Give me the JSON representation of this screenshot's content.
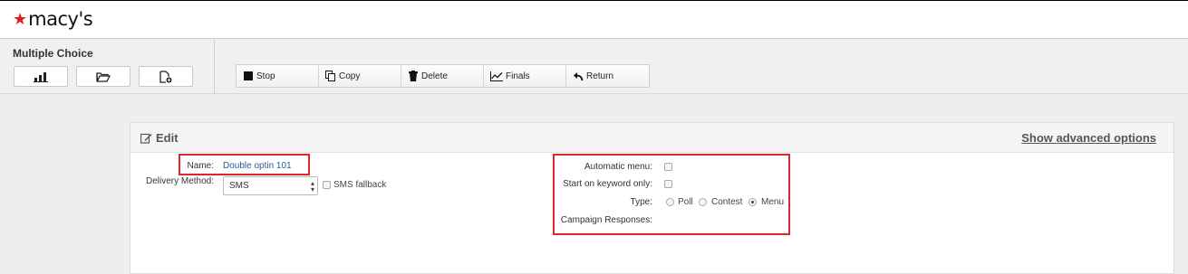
{
  "brand": {
    "name": "macy's",
    "star_color": "#e11b22"
  },
  "panel": {
    "title": "Multiple Choice"
  },
  "actions": [
    {
      "label": "Stop",
      "icon": "stop-icon"
    },
    {
      "label": "Copy",
      "icon": "copy-icon"
    },
    {
      "label": "Delete",
      "icon": "trash-icon"
    },
    {
      "label": "Finals",
      "icon": "line-chart-icon"
    },
    {
      "label": "Return",
      "icon": "return-arrow-icon"
    }
  ],
  "left_icon_buttons": [
    "bar-chart-icon",
    "folder-open-icon",
    "new-file-icon"
  ],
  "edit": {
    "title": "Edit",
    "advanced_link": "Show advanced options",
    "name_label": "Name:",
    "name_value": "Double optin 101",
    "delivery_label": "Delivery Method:",
    "delivery_value": "SMS",
    "sms_fallback_label": "SMS fallback",
    "auto_menu_label": "Automatic menu:",
    "keyword_only_label": "Start on keyword only:",
    "type_label": "Type:",
    "type_options": [
      "Poll",
      "Contest",
      "Menu"
    ],
    "type_selected": "Menu",
    "campaign_responses_label": "Campaign Responses:"
  },
  "colors": {
    "highlight": "#e0262c",
    "link": "#2a5a9a"
  }
}
